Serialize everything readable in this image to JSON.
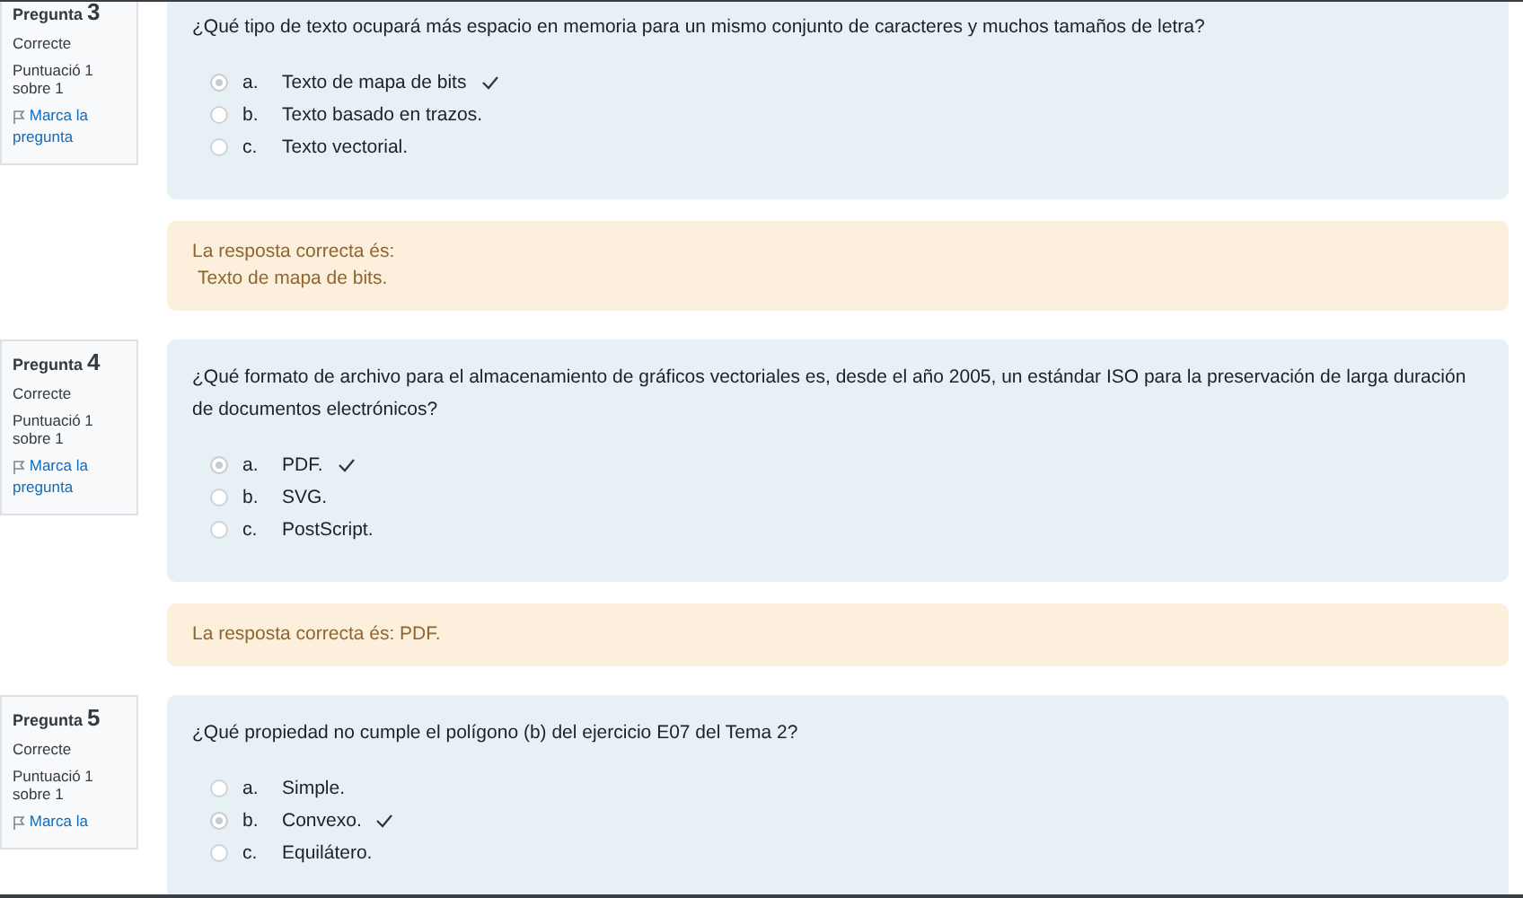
{
  "questions": [
    {
      "label": "Pregunta",
      "number": "3",
      "state": "Correcte",
      "mark": "Puntuació 1 sobre 1",
      "flag": "Marca la pregunta",
      "text": "¿Qué tipo de texto ocupará más espacio en memoria para un mismo conjunto de caracteres y muchos tamaños de letra?",
      "options": [
        {
          "letter": "a.",
          "text": "Texto de mapa de bits",
          "selected": true,
          "correct": true
        },
        {
          "letter": "b.",
          "text": "Texto basado en trazos.",
          "selected": false,
          "correct": false
        },
        {
          "letter": "c.",
          "text": "Texto vectorial.",
          "selected": false,
          "correct": false
        }
      ],
      "feedback": [
        "La resposta correcta és:",
        "Texto de mapa de bits."
      ]
    },
    {
      "label": "Pregunta",
      "number": "4",
      "state": "Correcte",
      "mark": "Puntuació 1 sobre 1",
      "flag": "Marca la pregunta",
      "text": "¿Qué formato de archivo para el almacenamiento de gráficos vectoriales es, desde el año 2005, un estándar ISO para la preservación de larga duración de documentos electrónicos?",
      "options": [
        {
          "letter": "a.",
          "text": "PDF.",
          "selected": true,
          "correct": true
        },
        {
          "letter": "b.",
          "text": "SVG.",
          "selected": false,
          "correct": false
        },
        {
          "letter": "c.",
          "text": "PostScript.",
          "selected": false,
          "correct": false
        }
      ],
      "feedback": [
        "La resposta correcta és: PDF."
      ]
    },
    {
      "label": "Pregunta",
      "number": "5",
      "state": "Correcte",
      "mark": "Puntuació 1 sobre 1",
      "flag": "Marca la",
      "text": "¿Qué propiedad no cumple el polígono (b) del ejercicio E07 del Tema 2?",
      "options": [
        {
          "letter": "a.",
          "text": "Simple.",
          "selected": false,
          "correct": false
        },
        {
          "letter": "b.",
          "text": "Convexo.",
          "selected": true,
          "correct": true
        },
        {
          "letter": "c.",
          "text": "Equilátero.",
          "selected": false,
          "correct": false
        }
      ]
    }
  ]
}
